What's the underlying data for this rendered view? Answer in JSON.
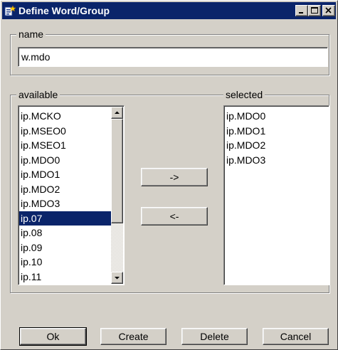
{
  "window": {
    "title": "Define Word/Group"
  },
  "name_group": {
    "legend": "name",
    "value": "w.mdo"
  },
  "available": {
    "legend": "available",
    "items": [
      "ip.MCKO",
      "ip.MSEO0",
      "ip.MSEO1",
      "ip.MDO0",
      "ip.MDO1",
      "ip.MDO2",
      "ip.MDO3",
      "ip.07",
      "ip.08",
      "ip.09",
      "ip.10",
      "ip.11"
    ],
    "selected_index": 7
  },
  "selected": {
    "legend": "selected",
    "items": [
      "ip.MDO0",
      "ip.MDO1",
      "ip.MDO2",
      "ip.MDO3"
    ]
  },
  "move": {
    "add_label": "->",
    "remove_label": "<-"
  },
  "buttons": {
    "ok": "Ok",
    "create": "Create",
    "delete": "Delete",
    "cancel": "Cancel"
  },
  "colors": {
    "face": "#d4d0c8",
    "titlebar": "#0a246a",
    "selection": "#0a246a"
  }
}
